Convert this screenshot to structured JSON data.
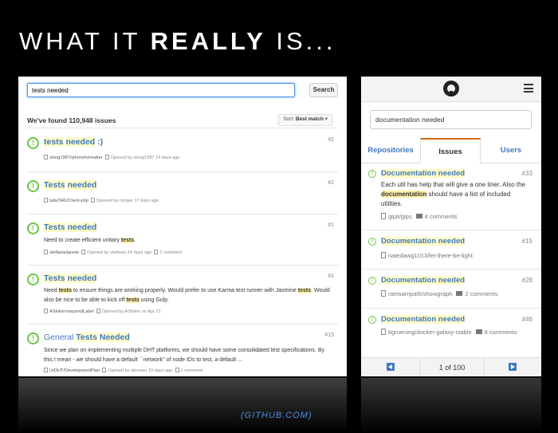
{
  "slide": {
    "title_prefix": "WHAT IT ",
    "title_bold": "REALLY",
    "title_suffix": " IS...",
    "source": "(GITHUB.COM)"
  },
  "desktop": {
    "search_value": "tests needed",
    "search_button": "Search",
    "found_text": "We've found 110,948 issues",
    "sort_label": "Sort: ",
    "sort_value": "Best match",
    "issues": [
      {
        "t1": "tests",
        "t2": "needed",
        "t3": ":)",
        "num": "#2",
        "repo": "siong1987/iphoneformatter",
        "meta": "Opened by siong1987 14 days ago"
      },
      {
        "t1": "Tests",
        "t2": "needed",
        "num": "#2",
        "repo": "talis/SRUClient-php",
        "meta": "Opened by rsinger 17 days ago"
      },
      {
        "t1": "Tests",
        "t2": "needed",
        "num": "#1",
        "body_a": "Need to create efficient unitary ",
        "body_b": "tests",
        "body_c": ".",
        "repo": "stellasia/janote",
        "meta": "Opened by stellasia 24 days ago",
        "comments": "1 comment"
      },
      {
        "t1": "Tests",
        "t2": "needed",
        "num": "#2",
        "body_a": "Need ",
        "body_b": "tests",
        "body_c": " to ensure things are working properly. Would prefer to use Karma test runner with Jasmine ",
        "body_d": "tests",
        "body_e": ". Would also be nice to be able to kick off ",
        "body_f": "tests",
        "body_g": " using Gulp.",
        "repo": "AStoker/requiredLabel",
        "meta": "Opened by AStoker on Apr 21"
      },
      {
        "t0": "General",
        "t1": "Tests",
        "t2": "Needed",
        "num": "#15",
        "body": "Since we plan on implementing multiple DHT platforms, we should have some consolidated test specifications. By this I mean - we should have a default ``network'' of node IDs to test, a default ...",
        "repo": "UrDHT/DevelopmentPlan",
        "meta": "Opened by abrosen 10 days ago",
        "comments": "1 comment"
      }
    ]
  },
  "mobile": {
    "search_value": "documentation needed",
    "tabs": [
      "Repositories",
      "Issues",
      "Users"
    ],
    "issues": [
      {
        "title": "Documentation needed",
        "num": "#33",
        "body_a": "Each util has help that will give a one liner. Also the ",
        "body_b": "documentation",
        "body_c": " should have a list of included utilities.",
        "repo": "gipit/gips",
        "comments": "4 comments"
      },
      {
        "title": "Documentation needed",
        "num": "#15",
        "repo": "natedawg1013/let-there-be-light"
      },
      {
        "title": "Documentation needed",
        "num": "#28",
        "repo": "ramsampath/showgraph",
        "comments": "2 comments"
      },
      {
        "title": "Documentation needed",
        "num": "#46",
        "repo": "bgruening/docker-galaxy-stable",
        "comments": "8 comments"
      }
    ],
    "pager": "1 of 100"
  },
  "colors": {
    "link": "#4078c0",
    "open_icon": "#6cc644",
    "highlight": "#fff2a8",
    "active_tab": "#d26911"
  }
}
